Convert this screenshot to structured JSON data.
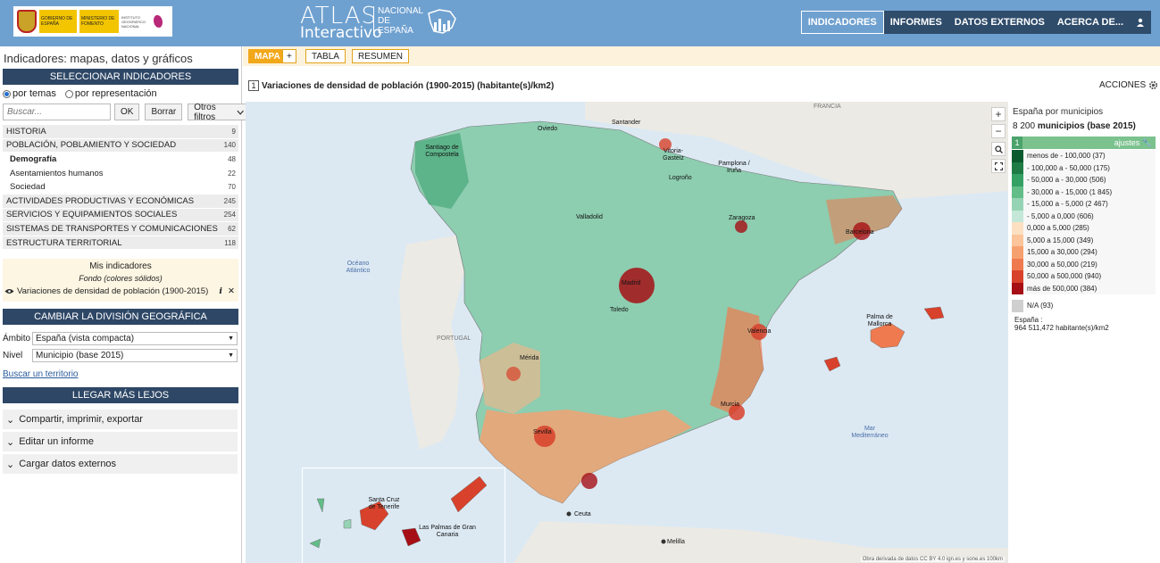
{
  "header": {
    "gov_text_1": "GOBIERNO DE ESPAÑA",
    "gov_text_2": "MINISTERIO DE FOMENTO",
    "ign_text": "INSTITUTO GEOGRÁFICO NACIONAL",
    "atlas_title": "ATLAS",
    "atlas_subtitle": "Interactivo",
    "atlas_nacional": "NACIONAL DE ESPAÑA",
    "nav": [
      "INDICADORES",
      "INFORMES",
      "DATOS EXTERNOS",
      "ACERCA DE..."
    ]
  },
  "left": {
    "title": "Indicadores: mapas, datos y gráficos",
    "select_header": "SELECCIONAR INDICADORES",
    "radio_temas": "por temas",
    "radio_representacion": "por representación",
    "search_placeholder": "Buscar...",
    "ok": "OK",
    "borrar": "Borrar",
    "otros_filtros": "Otros filtros",
    "themes": [
      {
        "label": "HISTORIA",
        "count": "9"
      },
      {
        "label": "POBLACIÓN, POBLAMIENTO Y SOCIEDAD",
        "count": "140"
      },
      {
        "label": "Demografía",
        "count": "48"
      },
      {
        "label": "Asentamientos humanos",
        "count": "22"
      },
      {
        "label": "Sociedad",
        "count": "70"
      },
      {
        "label": "ACTIVIDADES PRODUCTIVAS Y ECONÓMICAS",
        "count": "245"
      },
      {
        "label": "SERVICIOS Y EQUIPAMIENTOS SOCIALES",
        "count": "254"
      },
      {
        "label": "SISTEMAS DE TRANSPORTES Y COMUNICACIONES",
        "count": "62"
      },
      {
        "label": "ESTRUCTURA TERRITORIAL",
        "count": "118"
      }
    ],
    "mis_indicadores": "Mis indicadores",
    "fondo": "Fondo (colores sólidos)",
    "mis_item": "Variaciones de densidad de población (1900-2015)",
    "cambiar_header": "CAMBIAR LA DIVISIÓN GEOGRÁFICA",
    "ambito_label": "Ámbito",
    "ambito_value": "España (vista compacta)",
    "nivel_label": "Nivel",
    "nivel_value": "Municipio (base 2015)",
    "buscar_territorio": "Buscar un territorio",
    "llegar_header": "LLEGAR MÁS LEJOS",
    "accordions": [
      "Compartir, imprimir, exportar",
      "Editar un informe",
      "Cargar datos externos"
    ]
  },
  "tabs": {
    "mapa": "MAPA",
    "plus": "+",
    "tabla": "TABLA",
    "resumen": "RESUMEN"
  },
  "indicator": {
    "num": "1",
    "title": "Variaciones de densidad de población (1900-2015) (habitante(s)/km2)"
  },
  "acciones": "ACCIONES",
  "map": {
    "labels": {
      "francia": "FRANCIA",
      "portugal": "PORTUGAL",
      "oceano": "Océano Atlántico",
      "mar": "Mar Mediterráneo",
      "oviedo": "Oviedo",
      "santander": "Santander",
      "santiago": "Santiago de Compostela",
      "vitoria": "Vitoria-Gasteiz",
      "pamplona": "Pamplona / Iruña",
      "logrono": "Logroño",
      "valladolid": "Valladolid",
      "zaragoza": "Zaragoza",
      "barcelona": "Barcelona",
      "madrid": "Madrid",
      "toledo": "Toledo",
      "valencia": "Valencia",
      "palma": "Palma de Mallorca",
      "merida": "Mérida",
      "murcia": "Murcia",
      "sevilla": "Sevilla",
      "ceuta": "Ceuta",
      "melilla": "Melilla",
      "santa_cruz": "Santa Cruz de Tenerife",
      "las_palmas": "Las Palmas de Gran Canaria"
    },
    "attribution": "Obra derivada de datos CC BY 4.0 ign.es y sone.es   100km"
  },
  "legend": {
    "title": "España por municipios",
    "count": "8 200",
    "unit_text": "municipios (base 2015)",
    "num": "1",
    "ajustes": "ajustes",
    "items": [
      {
        "label": "menos de - 100,000 (37)",
        "color": "#0b5a2e"
      },
      {
        "label": "- 100,000 a - 50,000 (175)",
        "color": "#1e7b45"
      },
      {
        "label": "- 50,000 a - 30,000 (506)",
        "color": "#35a064"
      },
      {
        "label": "- 30,000 a - 15,000 (1 845)",
        "color": "#62bd89"
      },
      {
        "label": "- 15,000 a - 5,000 (2 467)",
        "color": "#96d3b4"
      },
      {
        "label": "- 5,000 a 0,000 (606)",
        "color": "#c5e7d8"
      },
      {
        "label": "0,000 a 5,000 (285)",
        "color": "#fde0c2"
      },
      {
        "label": "5,000 a 15,000 (349)",
        "color": "#fbc49a"
      },
      {
        "label": "15,000 a 30,000 (294)",
        "color": "#f7a06f"
      },
      {
        "label": "30,000 a 50,000 (219)",
        "color": "#ef7a4f"
      },
      {
        "label": "50,000 a 500,000 (940)",
        "color": "#d8412b"
      },
      {
        "label": "más de 500,000 (384)",
        "color": "#a50f15"
      }
    ],
    "na_label": "N/A (93)",
    "na_color": "#cfcfcf",
    "total_label": "España :",
    "total_value": "964 511,472 habitante(s)/km2"
  }
}
